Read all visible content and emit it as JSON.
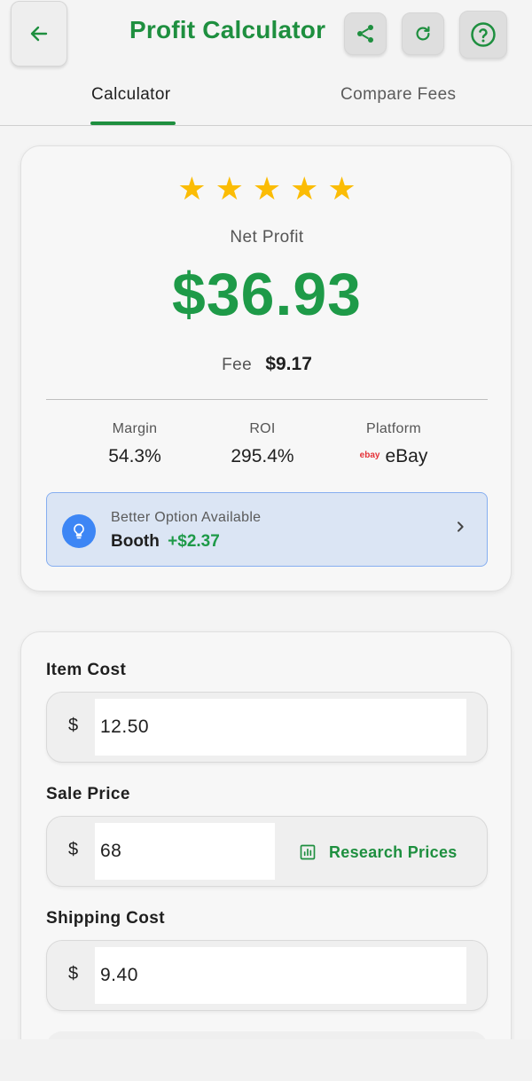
{
  "header": {
    "title": "Profit Calculator"
  },
  "tabs": [
    {
      "label": "Calculator",
      "active": true
    },
    {
      "label": "Compare Fees",
      "active": false
    }
  ],
  "result": {
    "rating_stars": 5,
    "net_profit_label": "Net Profit",
    "net_profit_value": "$36.93",
    "fee_label": "Fee",
    "fee_value": "$9.17",
    "stats": {
      "margin_label": "Margin",
      "margin_value": "54.3%",
      "roi_label": "ROI",
      "roi_value": "295.4%",
      "platform_label": "Platform",
      "platform_logo": "ebay",
      "platform_value": "eBay"
    },
    "better_option": {
      "title": "Better Option Available",
      "platform": "Booth",
      "gain": "+$2.37"
    }
  },
  "inputs": {
    "item_cost": {
      "label": "Item Cost",
      "currency": "$",
      "value": "12.50"
    },
    "sale_price": {
      "label": "Sale Price",
      "currency": "$",
      "value": "68",
      "research_label": "Research Prices"
    },
    "shipping_cost": {
      "label": "Shipping Cost",
      "currency": "$",
      "value": "9.40"
    }
  },
  "colors": {
    "brand_green": "#1e8f3f",
    "profit_green": "#1e9a48",
    "star_yellow": "#fbbc05",
    "info_blue": "#3d86f5"
  }
}
